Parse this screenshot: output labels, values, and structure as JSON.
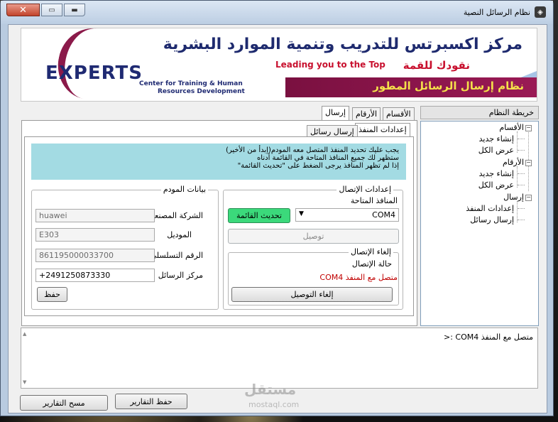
{
  "window": {
    "title": "نظام الرسائل النصية",
    "close_glyph": "✕",
    "maximize_glyph": "▭",
    "minimize_glyph": "▬",
    "app_icon_glyph": "◈"
  },
  "banner": {
    "arabic_title": "مركز اكسبرتس للتدريب وتنمية الموارد البشرية",
    "arabic_lead": "نقودك للقمة",
    "english_lead": "Leading you to the Top",
    "ribbon_text": "نظام إرسال الرسائل المطور",
    "logo_word": "EXPERTS",
    "logo_sub_line1": "Center for Training & Human",
    "logo_sub_line2": "Resources Development",
    "colors": {
      "navy": "#1e2a6e",
      "red": "#c8102e",
      "maroon": "#8b1a4a",
      "gold": "#f4e14a"
    }
  },
  "tree": {
    "header": "خريطة النظام",
    "nodes": [
      {
        "label": "الأقسام",
        "toggle": "−",
        "level": 0
      },
      {
        "label": "إنشاء جديد",
        "level": 1
      },
      {
        "label": "عرض الكل",
        "level": 1
      },
      {
        "label": "الأرقام",
        "toggle": "−",
        "level": 0
      },
      {
        "label": "إنشاء جديد",
        "level": 1
      },
      {
        "label": "عرض الكل",
        "level": 1
      },
      {
        "label": "إرسال",
        "toggle": "−",
        "level": 0
      },
      {
        "label": "إعدادات المنفذ",
        "level": 1
      },
      {
        "label": "إرسال رسائل",
        "level": 1
      }
    ]
  },
  "tabs": {
    "main": [
      "الأقسام",
      "الأرقام",
      "إرسال"
    ],
    "active_main": "إرسال",
    "sub": [
      "إعدادات المنفذ",
      "إرسال رسائل"
    ],
    "active_sub": "إعدادات المنفذ"
  },
  "info": {
    "line1": "يجب عليك تحديد المنفذ المتصل معه المودم(إبدأ من الأخير)",
    "line2": "ستظهر لك جميع المنافذ المتاحة في القائمة أدناه",
    "line3": "إذا لم تظهر المنافذ يرجى الضغط على \"تحديث القائمة\""
  },
  "connection": {
    "group_title": "إعدادات الإتصال",
    "ports_label": "المنافذ المتاحة",
    "selected_port": "COM4",
    "refresh_button": "تحديث القائمة",
    "connect_button": "توصيل",
    "disconnect_group_title": "إلغاء الإتصال",
    "status_label": "حالة الإتصال",
    "status_value": "متصل مع المنفذ COM4",
    "disconnect_button": "إلغاء التوصيل"
  },
  "modem": {
    "group_title": "بيانات المودم",
    "manufacturer_label": "الشركة المصنعة",
    "manufacturer_value": "huawei",
    "model_label": "الموديل",
    "model_value": "E303",
    "serial_label": "الرقم التسلسلي",
    "serial_value": "861195000033700",
    "smsc_label": "مركز الرسائل",
    "smsc_value": "+2491250873330",
    "save_button": "حفظ"
  },
  "log": {
    "line1": "متصل مع المنفذ COM4 :<"
  },
  "footer": {
    "save_reports_button": "حفظ التقارير",
    "clear_reports_button": "مسح التقارير"
  },
  "watermark": {
    "text": "مستقل",
    "sub": "mostaql.com"
  }
}
